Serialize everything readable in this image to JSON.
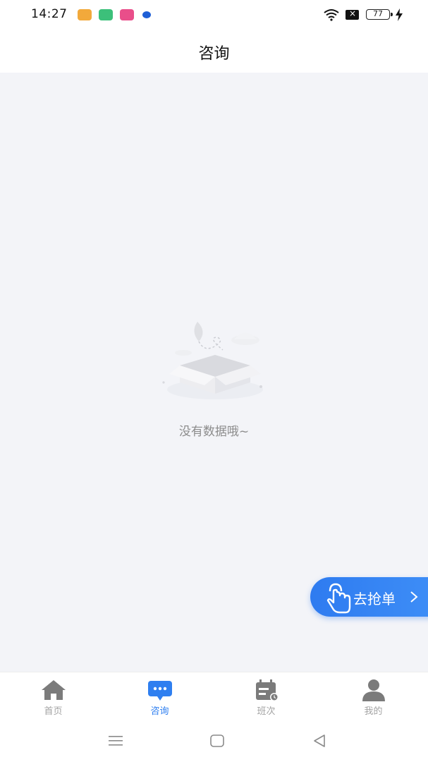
{
  "status_bar": {
    "time": "14:27",
    "battery": "77",
    "icons": [
      "app-notification-icon",
      "app-notification-icon",
      "app-notification-icon",
      "app-notification-icon",
      "wifi-icon",
      "sim-off-icon",
      "battery-icon",
      "charging-icon"
    ]
  },
  "header": {
    "title": "咨询"
  },
  "empty_state": {
    "message": "没有数据哦~",
    "icon": "empty-box-illustration"
  },
  "grab_button": {
    "label": "去抢单",
    "icon": "tap-hand-icon",
    "accent_color": "#2F7FF0"
  },
  "tabs": [
    {
      "label": "首页",
      "icon": "home-icon",
      "active": false
    },
    {
      "label": "咨询",
      "icon": "chat-icon",
      "active": true
    },
    {
      "label": "班次",
      "icon": "calendar-icon",
      "active": false
    },
    {
      "label": "我的",
      "icon": "user-icon",
      "active": false
    }
  ],
  "colors": {
    "accent": "#2F7FF0",
    "inactive": "#A3A3A3",
    "background": "#F3F4F8"
  }
}
